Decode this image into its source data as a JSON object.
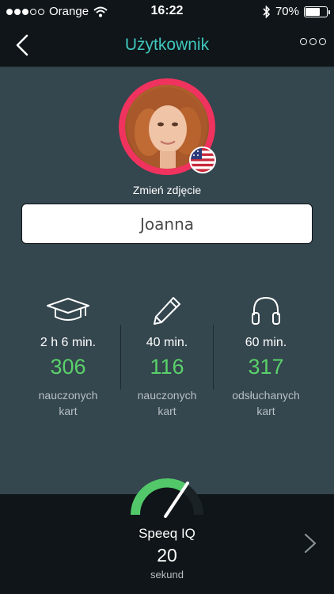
{
  "status_bar": {
    "carrier": "Orange",
    "time": "16:22",
    "battery": "70%",
    "battery_level": 0.7
  },
  "nav": {
    "title": "Użytkownik"
  },
  "profile": {
    "change_photo_label": "Zmień zdjęcie",
    "name": "Joanna"
  },
  "stats": [
    {
      "icon": "graduation-cap-icon",
      "time": "2 h 6 min.",
      "value": "306",
      "desc_line1": "nauczonych",
      "desc_line2": "kart"
    },
    {
      "icon": "pencil-icon",
      "time": "40 min.",
      "value": "116",
      "desc_line1": "nauczonych",
      "desc_line2": "kart"
    },
    {
      "icon": "headphones-icon",
      "time": "60 min.",
      "value": "317",
      "desc_line1": "odsłuchanych",
      "desc_line2": "kart"
    }
  ],
  "speeq": {
    "label": "Speeq IQ",
    "value": "20",
    "unit": "sekund"
  },
  "colors": {
    "accent_teal": "#3fc7be",
    "avatar_ring": "#f0335e",
    "stat_green": "#5ad16a",
    "background": "#34464e",
    "bar_dark": "#0f1518"
  }
}
